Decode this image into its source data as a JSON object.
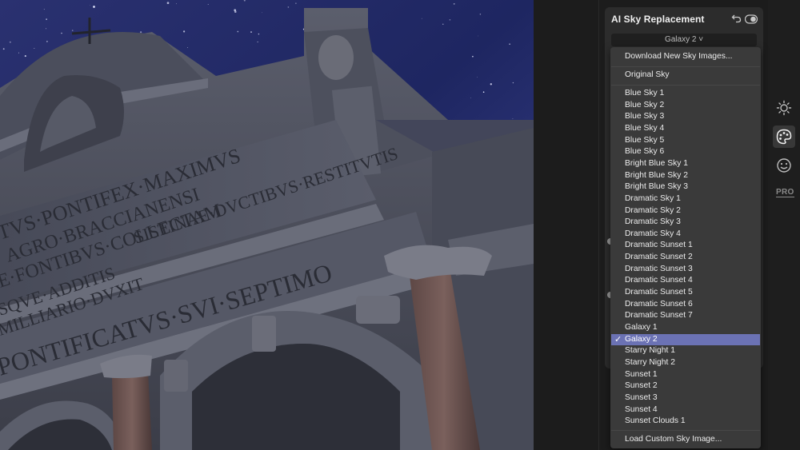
{
  "panel": {
    "title": "AI Sky Replacement",
    "selected_sky": "Galaxy 2 ˅"
  },
  "dropdown": {
    "top_action": "Download New Sky Images...",
    "original": "Original Sky",
    "items": [
      "Blue Sky 1",
      "Blue Sky 2",
      "Blue Sky 3",
      "Blue Sky 4",
      "Blue Sky 5",
      "Blue Sky 6",
      "Bright Blue Sky 1",
      "Bright Blue Sky 2",
      "Bright Blue Sky 3",
      "Dramatic Sky 1",
      "Dramatic Sky 2",
      "Dramatic Sky 3",
      "Dramatic Sky 4",
      "Dramatic Sunset 1",
      "Dramatic Sunset 2",
      "Dramatic Sunset 3",
      "Dramatic Sunset 4",
      "Dramatic Sunset 5",
      "Dramatic Sunset 6",
      "Dramatic Sunset 7",
      "Galaxy 1",
      "Galaxy 2",
      "Starry Night 1",
      "Starry Night 2",
      "Sunset 1",
      "Sunset 2",
      "Sunset 3",
      "Sunset 4",
      "Sunset Clouds 1"
    ],
    "selected": "Galaxy 2",
    "check": "✓",
    "bottom_action": "Load Custom Sky Image..."
  },
  "rail": {
    "pro": "PRO",
    "icons": [
      "sun-icon",
      "palette-icon",
      "face-icon"
    ]
  },
  "photo": {
    "inscription_1": "TVS·PONTIFEX·MAXIMVS",
    "inscription_2": "AGRO·BRACCIANENSI",
    "inscription_3": "E·FONTIBVS·COLLECTAM",
    "inscription_4": "SISTINAE·DVCTIBVS·RESTITVTIS",
    "inscription_5": "SQVE·ADDITIS",
    "inscription_6": "MILLIARIO·DVXIT",
    "inscription_7": "PONTIFICATVS·SVI·SEPTIMO"
  },
  "colors": {
    "selection": "#6b72b4",
    "dropdown_bg": "#3a3a3a",
    "panel_bg": "#2c2c2c"
  }
}
